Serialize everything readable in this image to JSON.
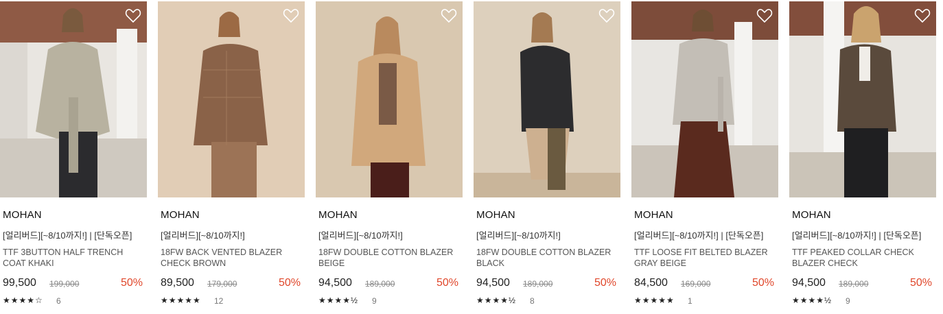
{
  "icons": {
    "wishlist": "heart-outline-icon",
    "star": "star-icon"
  },
  "colors": {
    "discount": "#e0472b",
    "text": "#222222",
    "muted": "#888888"
  },
  "products": [
    {
      "brand": "MOHAN",
      "promo": "[얼리버드][~8/10까지!] | [단독오픈]",
      "name": "TTF 3BUTTON HALF TRENCH COAT KHAKI",
      "price": "99,500",
      "original_price": "199,000",
      "discount": "50%",
      "rating": 4,
      "rating_display": "★★★★☆",
      "reviews": "6"
    },
    {
      "brand": "MOHAN",
      "promo": "[얼리버드][~8/10까지!]",
      "name": "18FW BACK VENTED BLAZER CHECK BROWN",
      "price": "89,500",
      "original_price": "179,000",
      "discount": "50%",
      "rating": 5,
      "rating_display": "★★★★★",
      "reviews": "12"
    },
    {
      "brand": "MOHAN",
      "promo": "[얼리버드][~8/10까지!]",
      "name": "18FW DOUBLE COTTON BLAZER BEIGE",
      "price": "94,500",
      "original_price": "189,000",
      "discount": "50%",
      "rating": 4.5,
      "rating_display": "★★★★½",
      "reviews": "9"
    },
    {
      "brand": "MOHAN",
      "promo": "[얼리버드][~8/10까지!]",
      "name": "18FW DOUBLE COTTON BLAZER BLACK",
      "price": "94,500",
      "original_price": "189,000",
      "discount": "50%",
      "rating": 4.5,
      "rating_display": "★★★★½",
      "reviews": "8"
    },
    {
      "brand": "MOHAN",
      "promo": "[얼리버드][~8/10까지!] | [단독오픈]",
      "name": "TTF LOOSE FIT BELTED BLAZER GRAY BEIGE",
      "price": "84,500",
      "original_price": "169,000",
      "discount": "50%",
      "rating": 5,
      "rating_display": "★★★★★",
      "reviews": "1"
    },
    {
      "brand": "MOHAN",
      "promo": "[얼리버드][~8/10까지!] | [단독오픈]",
      "name": "TTF PEAKED COLLAR CHECK BLAZER CHECK",
      "price": "94,500",
      "original_price": "189,000",
      "discount": "50%",
      "rating": 4.5,
      "rating_display": "★★★★½",
      "reviews": "9"
    }
  ]
}
